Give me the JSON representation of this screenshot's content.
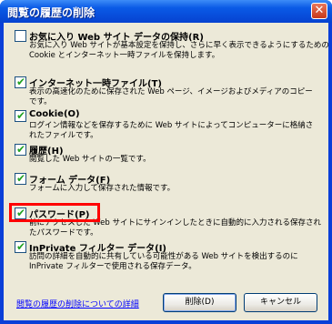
{
  "window": {
    "title": "閲覧の履歴の削除",
    "close_label": "✕"
  },
  "options": [
    {
      "label": "お気に入り Web サイト データの保持(R)",
      "checked": false,
      "desc": [
        "お気に入り Web サイトが基本設定を保持し、さらに早く表示できるようにするための",
        "Cookie とインターネット一時ファイルを保持します。"
      ]
    },
    {
      "label": "インターネット一時ファイル(T)",
      "checked": true,
      "desc": [
        "表示の高速化のために保存された Web ページ、イメージおよびメディアのコピー",
        "です。"
      ]
    },
    {
      "label": "Cookie(O)",
      "checked": true,
      "desc": [
        "ログイン情報などを保存するために Web サイトによってコンピューターに格納さ",
        "れたファイルです。"
      ]
    },
    {
      "label": "履歴(H)",
      "checked": true,
      "desc": [
        "閲覧した Web サイトの一覧です。"
      ]
    },
    {
      "label": "フォーム データ(F)",
      "checked": true,
      "desc": [
        "フォームに入力して保存された情報です。"
      ]
    },
    {
      "label": "パスワード(P)",
      "checked": true,
      "desc": [
        "前にアクセスした Web サイトにサインインしたときに自動的に入力される保存され",
        "たパスワードです。"
      ]
    },
    {
      "label": "InPrivate フィルター データ(I)",
      "checked": true,
      "desc": [
        "訪問の詳細を自動的に共有している可能性がある Web サイトを検出するのに",
        "InPrivate フィルターで使用される保存データ。"
      ]
    }
  ],
  "footer": {
    "link": "閲覧の履歴の削除についての詳細",
    "delete_label": "削除(D)",
    "cancel_label": "キャンセル"
  },
  "tick_glyph": "✔"
}
